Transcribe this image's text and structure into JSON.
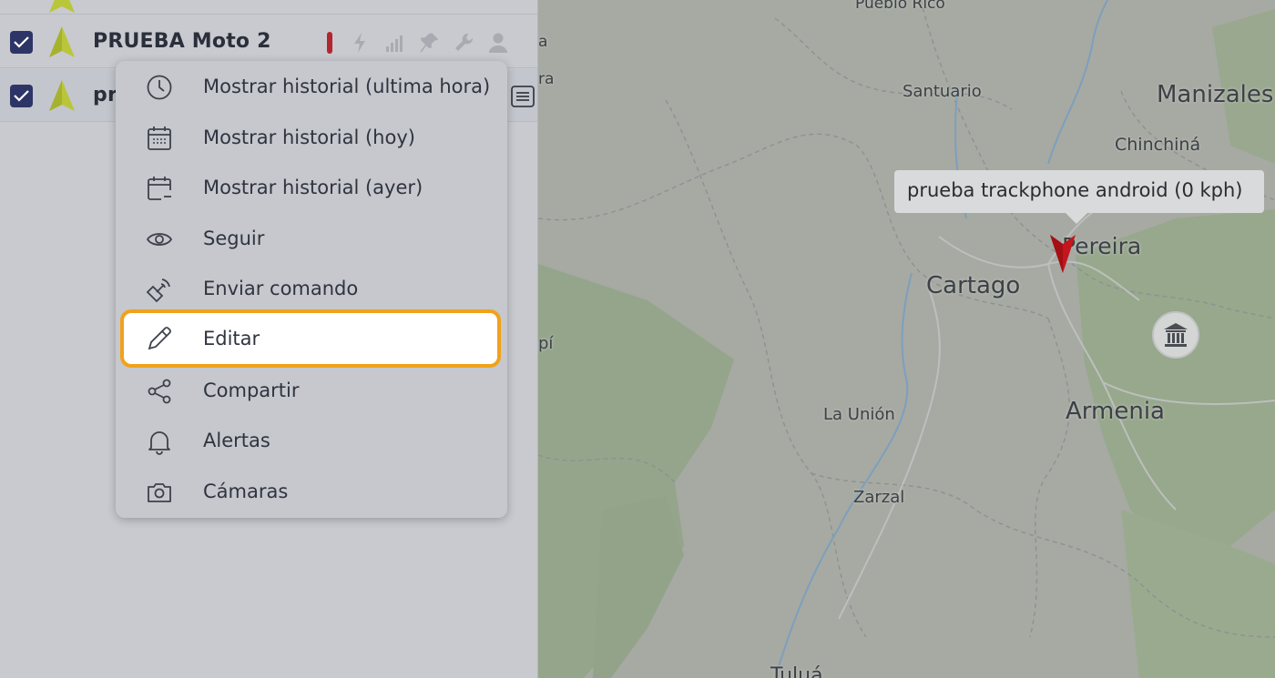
{
  "devices": [
    {
      "name": "PRUEBA Moto 2",
      "checked": true
    },
    {
      "name": "pr",
      "checked": true
    }
  ],
  "context_menu": {
    "items": [
      {
        "label": "Mostrar historial (ultima hora)",
        "icon": "clock-icon"
      },
      {
        "label": "Mostrar historial (hoy)",
        "icon": "calendar-icon"
      },
      {
        "label": "Mostrar historial (ayer)",
        "icon": "calendar-minus-icon"
      },
      {
        "label": "Seguir",
        "icon": "eye-icon"
      },
      {
        "label": "Enviar comando",
        "icon": "satellite-icon"
      },
      {
        "label": "Editar",
        "icon": "pencil-icon",
        "selected": true
      },
      {
        "label": "Compartir",
        "icon": "share-icon"
      },
      {
        "label": "Alertas",
        "icon": "bell-icon"
      },
      {
        "label": "Cámaras",
        "icon": "camera-icon"
      }
    ]
  },
  "map": {
    "tooltip": "prueba trackphone android (0 kph)",
    "labels": {
      "pueblo_rico": "Pueblo Rico",
      "santuario": "Santuario",
      "manizales": "Manizales",
      "chinchina": "Chinchiná",
      "pereira": "Pereira",
      "cartago": "Cartago",
      "armenia": "Armenia",
      "la_union": "La Unión",
      "zarzal": "Zarzal",
      "tulua": "Tuluá",
      "edge_a": "a",
      "edge_ra": "ra",
      "edge_pi": "pí"
    }
  },
  "colors": {
    "accent_highlight": "#f0a21a",
    "checkbox": "#2d3566",
    "status_red": "#b3262f",
    "marker_red": "#c4161c",
    "device_arrow": "#b9c63a"
  }
}
